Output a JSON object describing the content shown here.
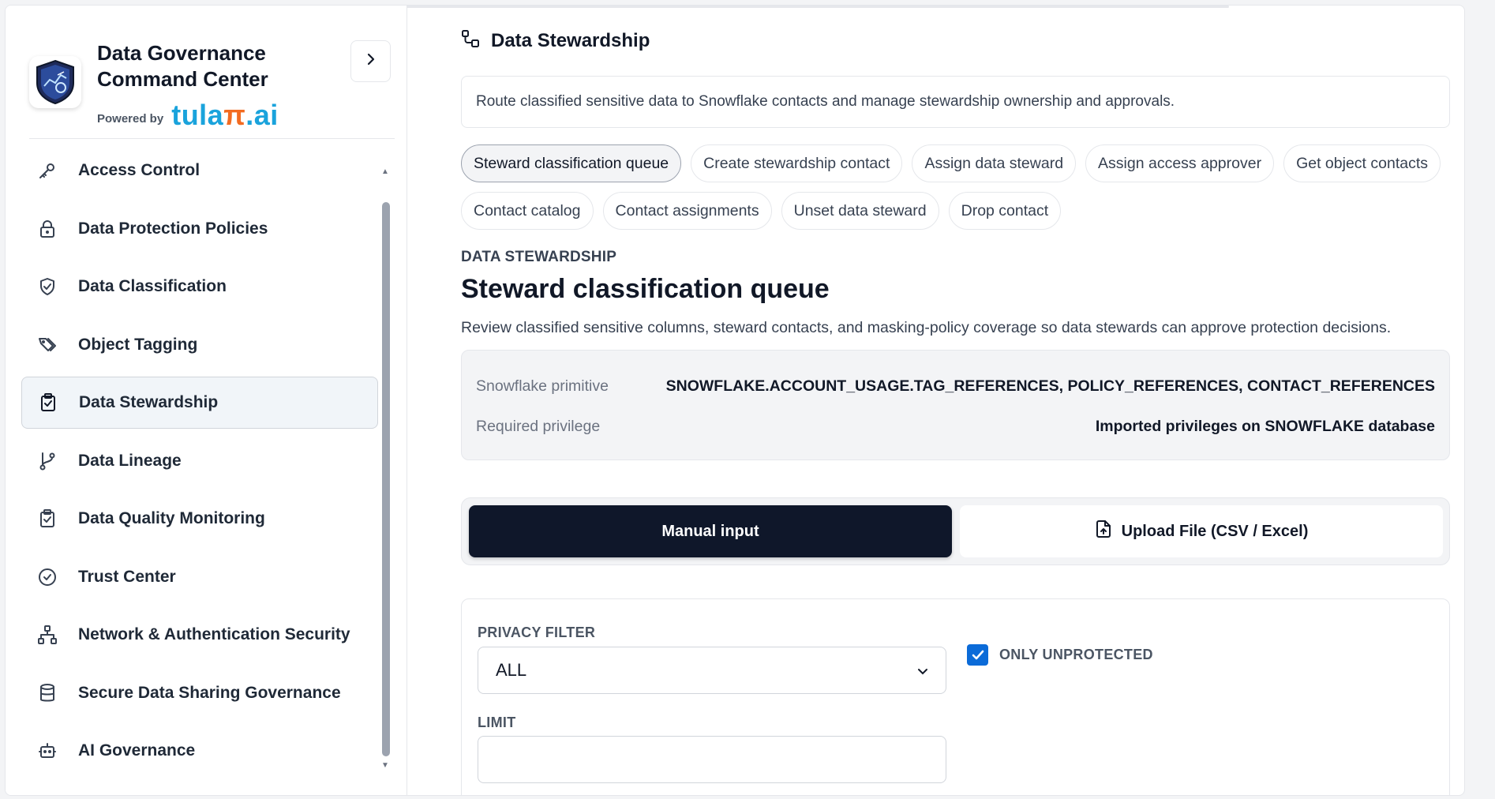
{
  "brand": {
    "title": "Data Governance Command Center",
    "powered_by": "Powered by",
    "logo_text_main": "tula",
    "logo_text_pi": "π",
    "logo_text_ai": ".ai"
  },
  "sidebar": {
    "items": [
      {
        "label": "Access Control",
        "icon": "key-icon"
      },
      {
        "label": "Data Protection Policies",
        "icon": "lock-icon"
      },
      {
        "label": "Data Classification",
        "icon": "shield-check-icon"
      },
      {
        "label": "Object Tagging",
        "icon": "tags-icon"
      },
      {
        "label": "Data Stewardship",
        "icon": "clipboard-check-icon",
        "active": true
      },
      {
        "label": "Data Lineage",
        "icon": "git-branch-icon"
      },
      {
        "label": "Data Quality Monitoring",
        "icon": "clipboard-check-icon"
      },
      {
        "label": "Trust Center",
        "icon": "check-circle-icon"
      },
      {
        "label": "Network & Authentication Security",
        "icon": "network-icon"
      },
      {
        "label": "Secure Data Sharing Governance",
        "icon": "database-icon"
      },
      {
        "label": "AI Governance",
        "icon": "bot-icon"
      }
    ]
  },
  "section": {
    "title": "Data Stewardship",
    "description": "Route classified sensitive data to Snowflake contacts and manage stewardship ownership and approvals."
  },
  "chips": {
    "row1": [
      "Steward classification queue",
      "Create stewardship contact",
      "Assign data steward",
      "Assign access approver",
      "Get object contacts"
    ],
    "row2": [
      "Contact catalog",
      "Contact assignments",
      "Unset data steward",
      "Drop contact"
    ],
    "active": "Steward classification queue"
  },
  "page": {
    "kicker": "DATA STEWARDSHIP",
    "title": "Steward classification queue",
    "subtitle": "Review classified sensitive columns, steward contacts, and masking-policy coverage so data stewards can approve protection decisions."
  },
  "info": {
    "primitive_label": "Snowflake primitive",
    "primitive_value": "SNOWFLAKE.ACCOUNT_USAGE.TAG_REFERENCES, POLICY_REFERENCES, CONTACT_REFERENCES",
    "privilege_label": "Required privilege",
    "privilege_value": "Imported privileges on SNOWFLAKE database"
  },
  "mode": {
    "manual_label": "Manual input",
    "upload_label": "Upload File (CSV / Excel)",
    "active": "manual"
  },
  "form": {
    "privacy_filter_label": "PRIVACY FILTER",
    "privacy_filter_value": "ALL",
    "only_unprotected_label": "ONLY UNPROTECTED",
    "only_unprotected_checked": true,
    "limit_label": "LIMIT",
    "limit_value": ""
  },
  "colors": {
    "accent": "#0b6bd8",
    "dark_button": "#0f172a",
    "brand_blue": "#1aa3dc",
    "brand_orange": "#f36b21"
  }
}
